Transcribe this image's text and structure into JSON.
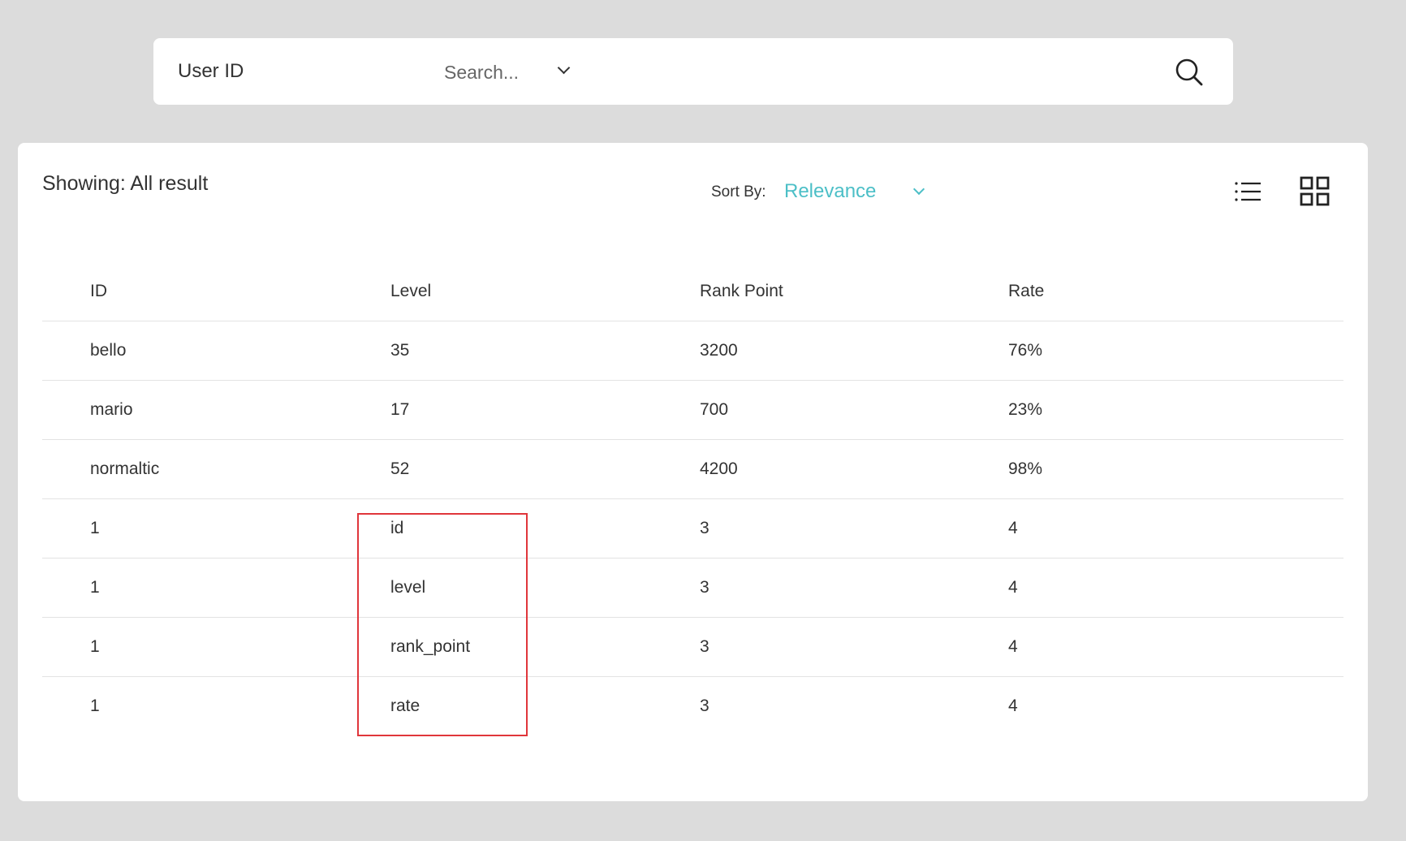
{
  "search": {
    "field_select": {
      "selected": "User ID"
    },
    "placeholder": "Search...",
    "value": ""
  },
  "results": {
    "showing_text": "Showing: All result",
    "sort": {
      "label": "Sort By:",
      "selected": "Relevance"
    },
    "view_modes": [
      "list",
      "grid"
    ],
    "columns": [
      "ID",
      "Level",
      "Rank Point",
      "Rate"
    ],
    "rows": [
      [
        "bello",
        "35",
        "3200",
        "76%"
      ],
      [
        "mario",
        "17",
        "700",
        "23%"
      ],
      [
        "normaltic",
        "52",
        "4200",
        "98%"
      ],
      [
        "1",
        "id",
        "3",
        "4"
      ],
      [
        "1",
        "level",
        "3",
        "4"
      ],
      [
        "1",
        "rank_point",
        "3",
        "4"
      ],
      [
        "1",
        "rate",
        "3",
        "4"
      ]
    ]
  },
  "colors": {
    "background": "#dcdcdc",
    "card": "#ffffff",
    "accent": "#4cbfc7",
    "highlight_border": "#e0363b"
  },
  "icons": {
    "search": "search-icon",
    "dropdown": "chevron-down-icon",
    "list_view": "list-view-icon",
    "grid_view": "grid-view-icon"
  }
}
